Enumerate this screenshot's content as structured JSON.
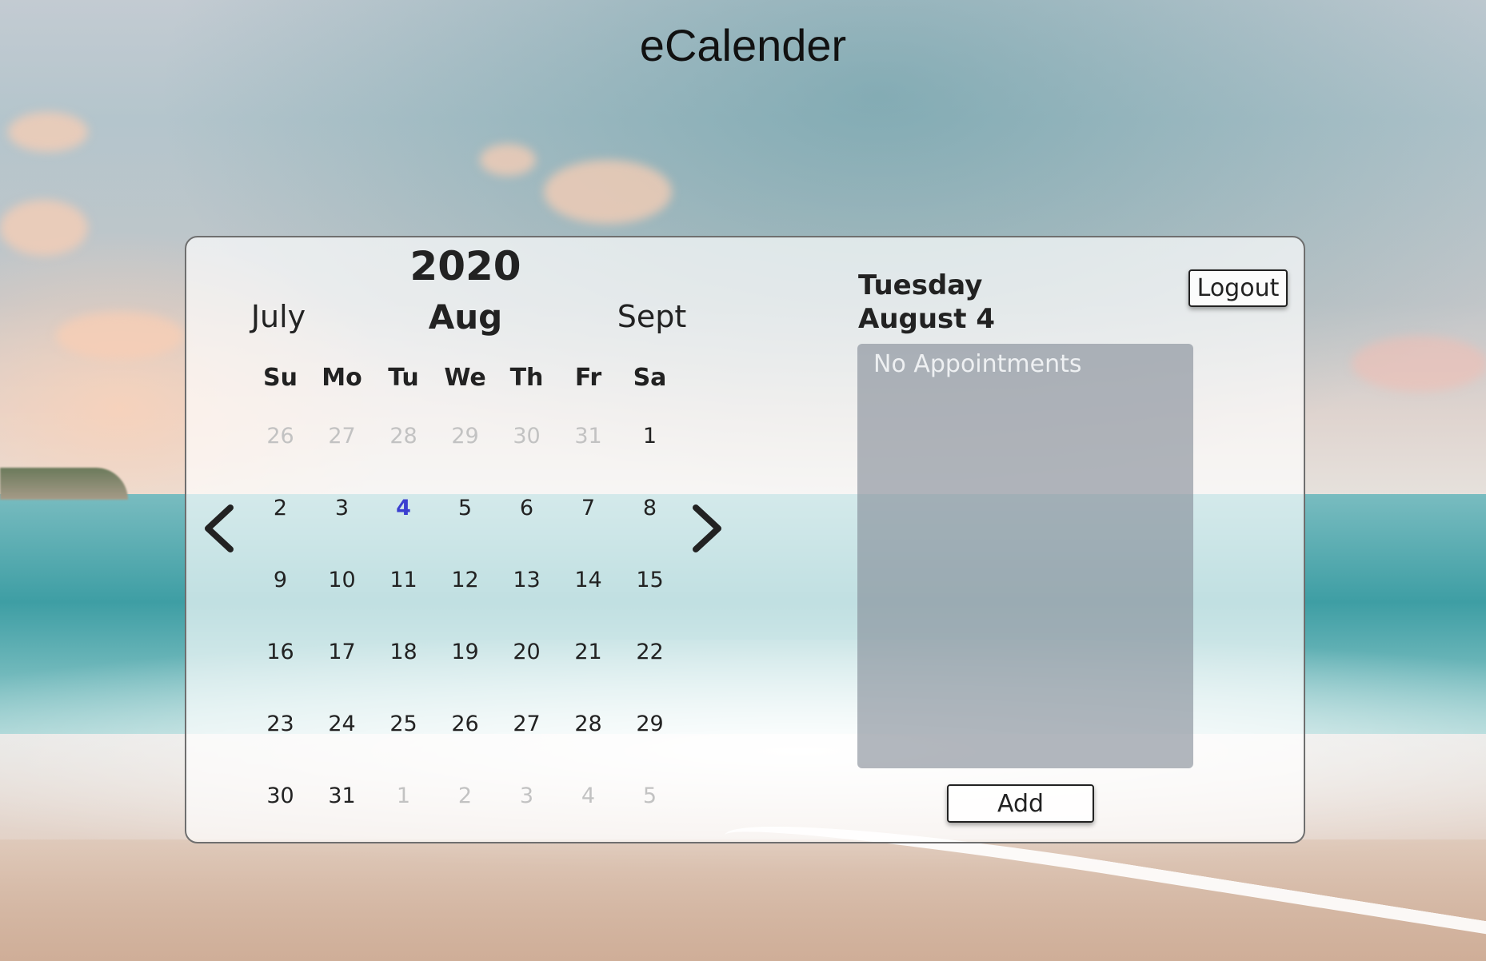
{
  "app": {
    "title": "eCalender"
  },
  "colors": {
    "selected_day": "#3b3fd0",
    "muted_day": "#c2c2c2",
    "appointments_bg": "#828a96"
  },
  "calendar": {
    "year": "2020",
    "prev_month": "July",
    "current_month": "Aug",
    "next_month": "Sept",
    "prev_icon": "chevron-left-icon",
    "next_icon": "chevron-right-icon",
    "weekdays": [
      "Su",
      "Mo",
      "Tu",
      "We",
      "Th",
      "Fr",
      "Sa"
    ],
    "weeks": [
      [
        {
          "d": "26",
          "muted": true
        },
        {
          "d": "27",
          "muted": true
        },
        {
          "d": "28",
          "muted": true
        },
        {
          "d": "29",
          "muted": true
        },
        {
          "d": "30",
          "muted": true
        },
        {
          "d": "31",
          "muted": true
        },
        {
          "d": "1"
        }
      ],
      [
        {
          "d": "2"
        },
        {
          "d": "3"
        },
        {
          "d": "4",
          "selected": true
        },
        {
          "d": "5"
        },
        {
          "d": "6"
        },
        {
          "d": "7"
        },
        {
          "d": "8"
        }
      ],
      [
        {
          "d": "9"
        },
        {
          "d": "10"
        },
        {
          "d": "11"
        },
        {
          "d": "12"
        },
        {
          "d": "13"
        },
        {
          "d": "14"
        },
        {
          "d": "15"
        }
      ],
      [
        {
          "d": "16"
        },
        {
          "d": "17"
        },
        {
          "d": "18"
        },
        {
          "d": "19"
        },
        {
          "d": "20"
        },
        {
          "d": "21"
        },
        {
          "d": "22"
        }
      ],
      [
        {
          "d": "23"
        },
        {
          "d": "24"
        },
        {
          "d": "25"
        },
        {
          "d": "26"
        },
        {
          "d": "27"
        },
        {
          "d": "28"
        },
        {
          "d": "29"
        }
      ],
      [
        {
          "d": "30"
        },
        {
          "d": "31"
        },
        {
          "d": "1",
          "muted": true
        },
        {
          "d": "2",
          "muted": true
        },
        {
          "d": "3",
          "muted": true
        },
        {
          "d": "4",
          "muted": true
        },
        {
          "d": "5",
          "muted": true
        }
      ]
    ]
  },
  "day_panel": {
    "weekday": "Tuesday",
    "date": "August 4",
    "logout_label": "Logout",
    "appointments_empty": "No Appointments",
    "add_label": "Add"
  }
}
